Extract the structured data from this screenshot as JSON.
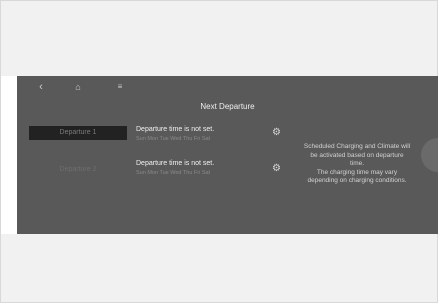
{
  "nav": {
    "back_icon": "chevron-left-icon",
    "home_icon": "home-icon",
    "menu_icon": "menu-icon"
  },
  "title": "Next Departure",
  "departures": [
    {
      "label": "Departure 1",
      "status": "Departure time is not set.",
      "days": "Sun Mon Tue Wed Thu Fri Sat",
      "settings_icon": "gear-icon"
    },
    {
      "label": "Departure 2",
      "status": "Departure time is not set.",
      "days": "Sun Mon Tue Wed Thu Fri Sat",
      "settings_icon": "gear-icon"
    }
  ],
  "notice": {
    "line1": "Scheduled Charging and Climate will be activated based on departure time.",
    "line2": "The charging time may vary depending on charging conditions."
  },
  "colors": {
    "screen_bg": "#595959",
    "selected_button": "#222222",
    "page_bg": "#f1f1f1"
  }
}
